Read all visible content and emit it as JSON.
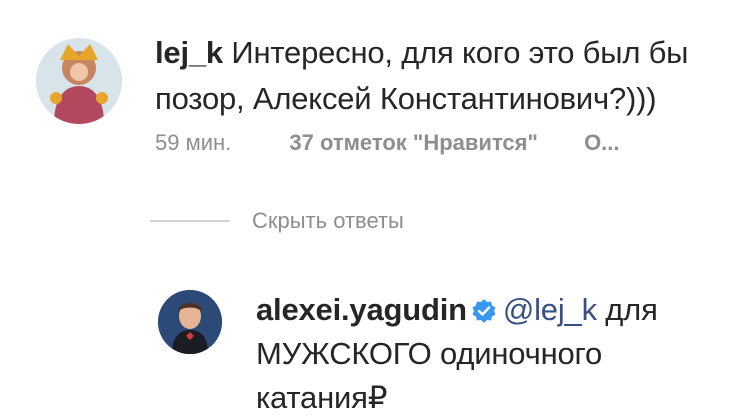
{
  "comments": [
    {
      "username": "lej_k",
      "text": "Интересно, для кого это был бы позор, Алексей Константинович?)))",
      "time": "59 мин.",
      "likes": "37 отметок \"Нравится\"",
      "reply_label": "О..."
    }
  ],
  "hide_replies_label": "Скрыть ответы",
  "reply": {
    "username": "alexei.yagudin",
    "mention": "@lej_k",
    "text": "для МУЖСКОГО одиночного катания₽"
  },
  "colors": {
    "text": "#262626",
    "secondary": "#8e8e8e",
    "mention": "#385185",
    "verified": "#3897f0"
  }
}
